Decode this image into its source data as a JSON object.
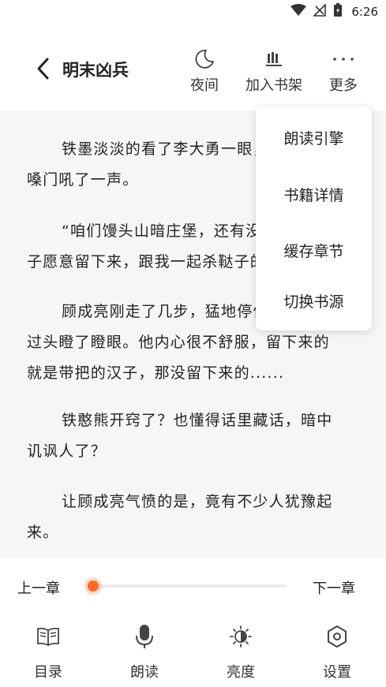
{
  "status_bar": {
    "time": "6:26",
    "icons": [
      "wifi-icon",
      "signal-icon",
      "battery-icon"
    ]
  },
  "header": {
    "title": "明末凶兵",
    "actions": [
      {
        "label": "夜间",
        "icon": "moon-icon"
      },
      {
        "label": "加入书架",
        "icon": "bookshelf-icon"
      },
      {
        "label": "更多",
        "icon": "more-icon"
      }
    ]
  },
  "dropdown_menu": {
    "items": [
      {
        "label": "朗读引擎"
      },
      {
        "label": "书籍详情"
      },
      {
        "label": "缓存章节"
      },
      {
        "label": "切换书源"
      }
    ]
  },
  "reader": {
    "paragraphs": [
      {
        "lines": [
          "铁墨淡淡的看了李大勇一眼，扯着",
          "嗓门吼了一声。"
        ]
      },
      {
        "lines": [
          "“咱们馒头山暗庄堡，还有没有汉",
          "子愿意留下来，跟我一起杀鞑子的？"
        ]
      },
      {
        "lines": [
          "顾成亮刚走了几步，猛地停住，转",
          "过头瞪了瞪眼。他内心很不舒服，留下来的",
          "就是带把的汉子，那没留下来的......"
        ]
      },
      {
        "lines": [
          "铁憨熊开窍了？也懂得话里藏话，暗中",
          "讥讽人了？"
        ]
      },
      {
        "lines": [
          "让顾成亮气愤的是，竟有不少人犹豫起",
          "来。"
        ]
      }
    ]
  },
  "chapter_nav": {
    "prev_label": "上一章",
    "next_label": "下一章",
    "progress": 0.0,
    "accent_color": "#ff6a28"
  },
  "bottom_nav": {
    "items": [
      {
        "label": "目录",
        "icon": "book-icon"
      },
      {
        "label": "朗读",
        "icon": "microphone-icon"
      },
      {
        "label": "亮度",
        "icon": "brightness-icon"
      },
      {
        "label": "设置",
        "icon": "settings-icon"
      }
    ]
  }
}
